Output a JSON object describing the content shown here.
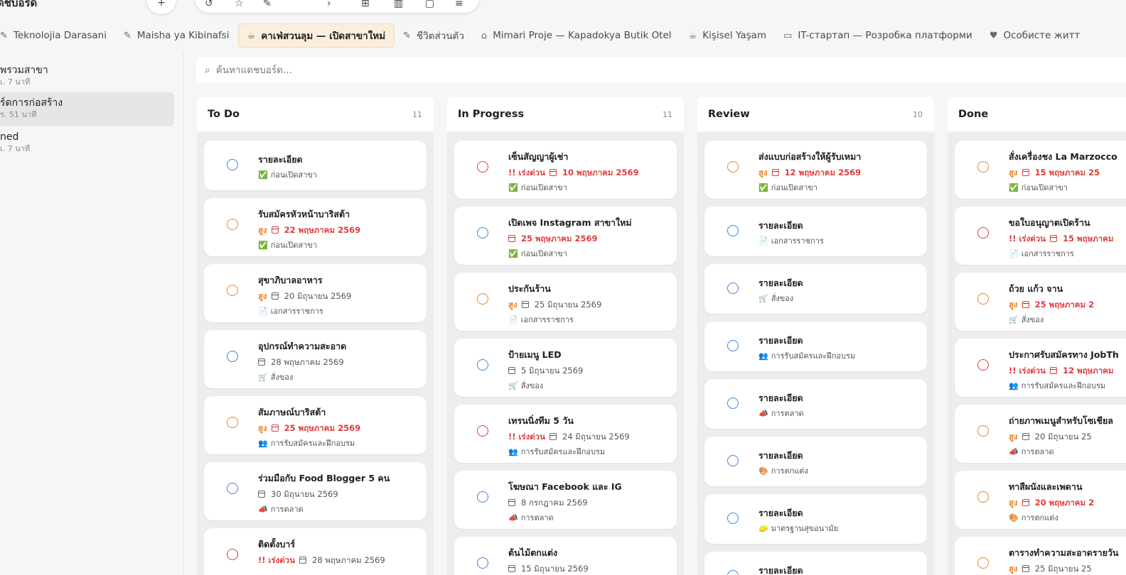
{
  "app": {
    "title": "ดชบอร์ด"
  },
  "toolbar": {
    "icons": [
      "share-icon",
      "star-icon",
      "brush-icon",
      "arrow-icon",
      "plus-box-icon",
      "trash-icon",
      "square-icon",
      "sliders-icon"
    ]
  },
  "tabs": [
    {
      "label": "Teknolojia Darasani",
      "icon": "pen-icon"
    },
    {
      "label": "Maisha ya Kibinafsi",
      "icon": "pen-icon"
    },
    {
      "label": "คาเฟ่สวนลุม — เปิดสาขาใหม่",
      "icon": "cup-icon",
      "active": true
    },
    {
      "label": "ชีวิตส่วนตัว",
      "icon": "pen-icon"
    },
    {
      "label": "Mimari Proje — Kapadokya Butik Otel",
      "icon": "building-icon"
    },
    {
      "label": "Kişisel Yaşam",
      "icon": "cup-icon"
    },
    {
      "label": "IT-стартап — Розробка платформи",
      "icon": "laptop-icon"
    },
    {
      "label": "Особисте житт",
      "icon": "heart-icon"
    }
  ],
  "sidebar": {
    "items": [
      {
        "title": "พรวมสาขา",
        "sub": "เ. 7 นาที"
      },
      {
        "title": "ร์ดการก่อสร้าง",
        "sub": "ร. 51 นาที",
        "active": true
      },
      {
        "title": "ned",
        "sub": "เ. 7 นาที"
      }
    ]
  },
  "search": {
    "placeholder": "ค้นหาแดชบอร์ด..."
  },
  "columns": [
    {
      "title": "To Do",
      "count": "11",
      "cards": [
        {
          "title": "รายละเอียด",
          "status": "blue",
          "tag": "ก่อนเปิดสาขา",
          "tag_icon": "✅"
        },
        {
          "title": "รับสมัครหัวหน้าบาริสต้า",
          "status": "orange",
          "priority": "สูง",
          "priority_kind": "high",
          "date": "22 พฤษภาคม 2569",
          "date_red": true,
          "tag": "ก่อนเปิดสาขา",
          "tag_icon": "✅"
        },
        {
          "title": "สุขาภิบาลอาหาร",
          "status": "orange",
          "priority": "สูง",
          "priority_kind": "high",
          "date": "20 มิถุนายน 2569",
          "tag": "เอกสารราชการ",
          "tag_icon": "📄"
        },
        {
          "title": "อุปกรณ์ทำความสะอาด",
          "status": "blue",
          "date": "28 พฤษภาคม 2569",
          "tag": "สั่งของ",
          "tag_icon": "🛒"
        },
        {
          "title": "สัมภาษณ์บาริสต้า",
          "status": "orange",
          "priority": "สูง",
          "priority_kind": "high",
          "date": "25 พฤษภาคม 2569",
          "date_red": true,
          "tag": "การรับสมัครและฝึกอบรม",
          "tag_icon": "👥"
        },
        {
          "title": "ร่วมมือกับ Food Blogger 5 คน",
          "status": "blue",
          "date": "30 มิถุนายน 2569",
          "tag": "การตลาด",
          "tag_icon": "📣"
        },
        {
          "title": "ติดตั้งบาร์",
          "status": "red",
          "priority": "!! เร่งด่วน",
          "priority_kind": "urgent",
          "date": "28 พฤษภาคม 2569",
          "tag": "",
          "tag_icon": ""
        }
      ]
    },
    {
      "title": "In Progress",
      "count": "11",
      "cards": [
        {
          "title": "เซ็นสัญญาผู้เช่า",
          "status": "red",
          "priority": "!! เร่งด่วน",
          "priority_kind": "urgent",
          "date": "10 พฤษภาคม 2569",
          "date_red": true,
          "tag": "ก่อนเปิดสาขา",
          "tag_icon": "✅"
        },
        {
          "title": "เปิดเพจ Instagram สาขาใหม่",
          "status": "blue",
          "date": "25 พฤษภาคม 2569",
          "date_red": true,
          "tag": "ก่อนเปิดสาขา",
          "tag_icon": "✅"
        },
        {
          "title": "ประกันร้าน",
          "status": "orange",
          "priority": "สูง",
          "priority_kind": "high",
          "date": "25 มิถุนายน 2569",
          "tag": "เอกสารราชการ",
          "tag_icon": "📄"
        },
        {
          "title": "ป้ายเมนู LED",
          "status": "blue",
          "date": "5 มิถุนายน 2569",
          "tag": "สั่งของ",
          "tag_icon": "🛒"
        },
        {
          "title": "เทรนนิ่งทีม 5 วัน",
          "status": "red",
          "priority": "!! เร่งด่วน",
          "priority_kind": "urgent",
          "date": "24 มิถุนายน 2569",
          "tag": "การรับสมัครและฝึกอบรม",
          "tag_icon": "👥"
        },
        {
          "title": "โฆษณา Facebook และ IG",
          "status": "blue",
          "date": "8 กรกฎาคม 2569",
          "tag": "การตลาด",
          "tag_icon": "📣"
        },
        {
          "title": "ต้นไม้ตกแต่ง",
          "status": "blue",
          "date": "15 มิถุนายน 2569",
          "tag": "",
          "tag_icon": ""
        }
      ]
    },
    {
      "title": "Review",
      "count": "10",
      "cards": [
        {
          "title": "ส่งแบบก่อสร้างให้ผู้รับเหมา",
          "status": "orange",
          "priority": "สูง",
          "priority_kind": "high",
          "date": "12 พฤษภาคม 2569",
          "date_red": true,
          "tag": "ก่อนเปิดสาขา",
          "tag_icon": "✅"
        },
        {
          "title": "รายละเอียด",
          "status": "blue",
          "tag": "เอกสารราชการ",
          "tag_icon": "📄"
        },
        {
          "title": "รายละเอียด",
          "status": "blue",
          "tag": "สั่งของ",
          "tag_icon": "🛒"
        },
        {
          "title": "รายละเอียด",
          "status": "blue",
          "tag": "การรับสมัครและฝึกอบรม",
          "tag_icon": "👥"
        },
        {
          "title": "รายละเอียด",
          "status": "blue",
          "tag": "การตลาด",
          "tag_icon": "📣"
        },
        {
          "title": "รายละเอียด",
          "status": "blue",
          "tag": "การตกแต่ง",
          "tag_icon": "🎨"
        },
        {
          "title": "รายละเอียด",
          "status": "blue",
          "tag": "มาตรฐานสุขอนามัย",
          "tag_icon": "🧽"
        },
        {
          "title": "รายละเอียด",
          "status": "blue",
          "tag": "",
          "tag_icon": ""
        }
      ]
    },
    {
      "title": "Done",
      "count": "",
      "cards": [
        {
          "title": "สั่งเครื่องชง La Marzocco",
          "status": "orange",
          "priority": "สูง",
          "priority_kind": "high",
          "date": "15 พฤษภาคม 25",
          "date_red": true,
          "tag": "ก่อนเปิดสาขา",
          "tag_icon": "✅"
        },
        {
          "title": "ขอใบอนุญาตเปิดร้าน",
          "status": "red",
          "priority": "!! เร่งด่วน",
          "priority_kind": "urgent",
          "date": "15 พฤษภาคม",
          "date_red": true,
          "tag": "เอกสารราชการ",
          "tag_icon": "📄"
        },
        {
          "title": "ถ้วย แก้ว จาน",
          "status": "orange",
          "priority": "สูง",
          "priority_kind": "high",
          "date": "25 พฤษภาคม 2",
          "date_red": true,
          "tag": "สั่งของ",
          "tag_icon": "🛒"
        },
        {
          "title": "ประกาศรับสมัครทาง JobTh",
          "status": "red",
          "priority": "!! เร่งด่วน",
          "priority_kind": "urgent",
          "date": "12 พฤษภาคม",
          "date_red": true,
          "tag": "การรับสมัครและฝึกอบรม",
          "tag_icon": "👥"
        },
        {
          "title": "ถ่ายภาพเมนูสำหรับโซเชียล",
          "status": "orange",
          "priority": "สูง",
          "priority_kind": "high",
          "date": "20 มิถุนายน 25",
          "tag": "การตลาด",
          "tag_icon": "📣"
        },
        {
          "title": "ทาสีผนังและเพดาน",
          "status": "orange",
          "priority": "สูง",
          "priority_kind": "high",
          "date": "20 พฤษภาคม 2",
          "date_red": true,
          "tag": "การตกแต่ง",
          "tag_icon": "🎨"
        },
        {
          "title": "ตารางทำความสะอาดรายวัน",
          "status": "orange",
          "priority": "สูง",
          "priority_kind": "high",
          "date": "25 มิถุนายน 25",
          "tag": "",
          "tag_icon": ""
        }
      ]
    }
  ]
}
